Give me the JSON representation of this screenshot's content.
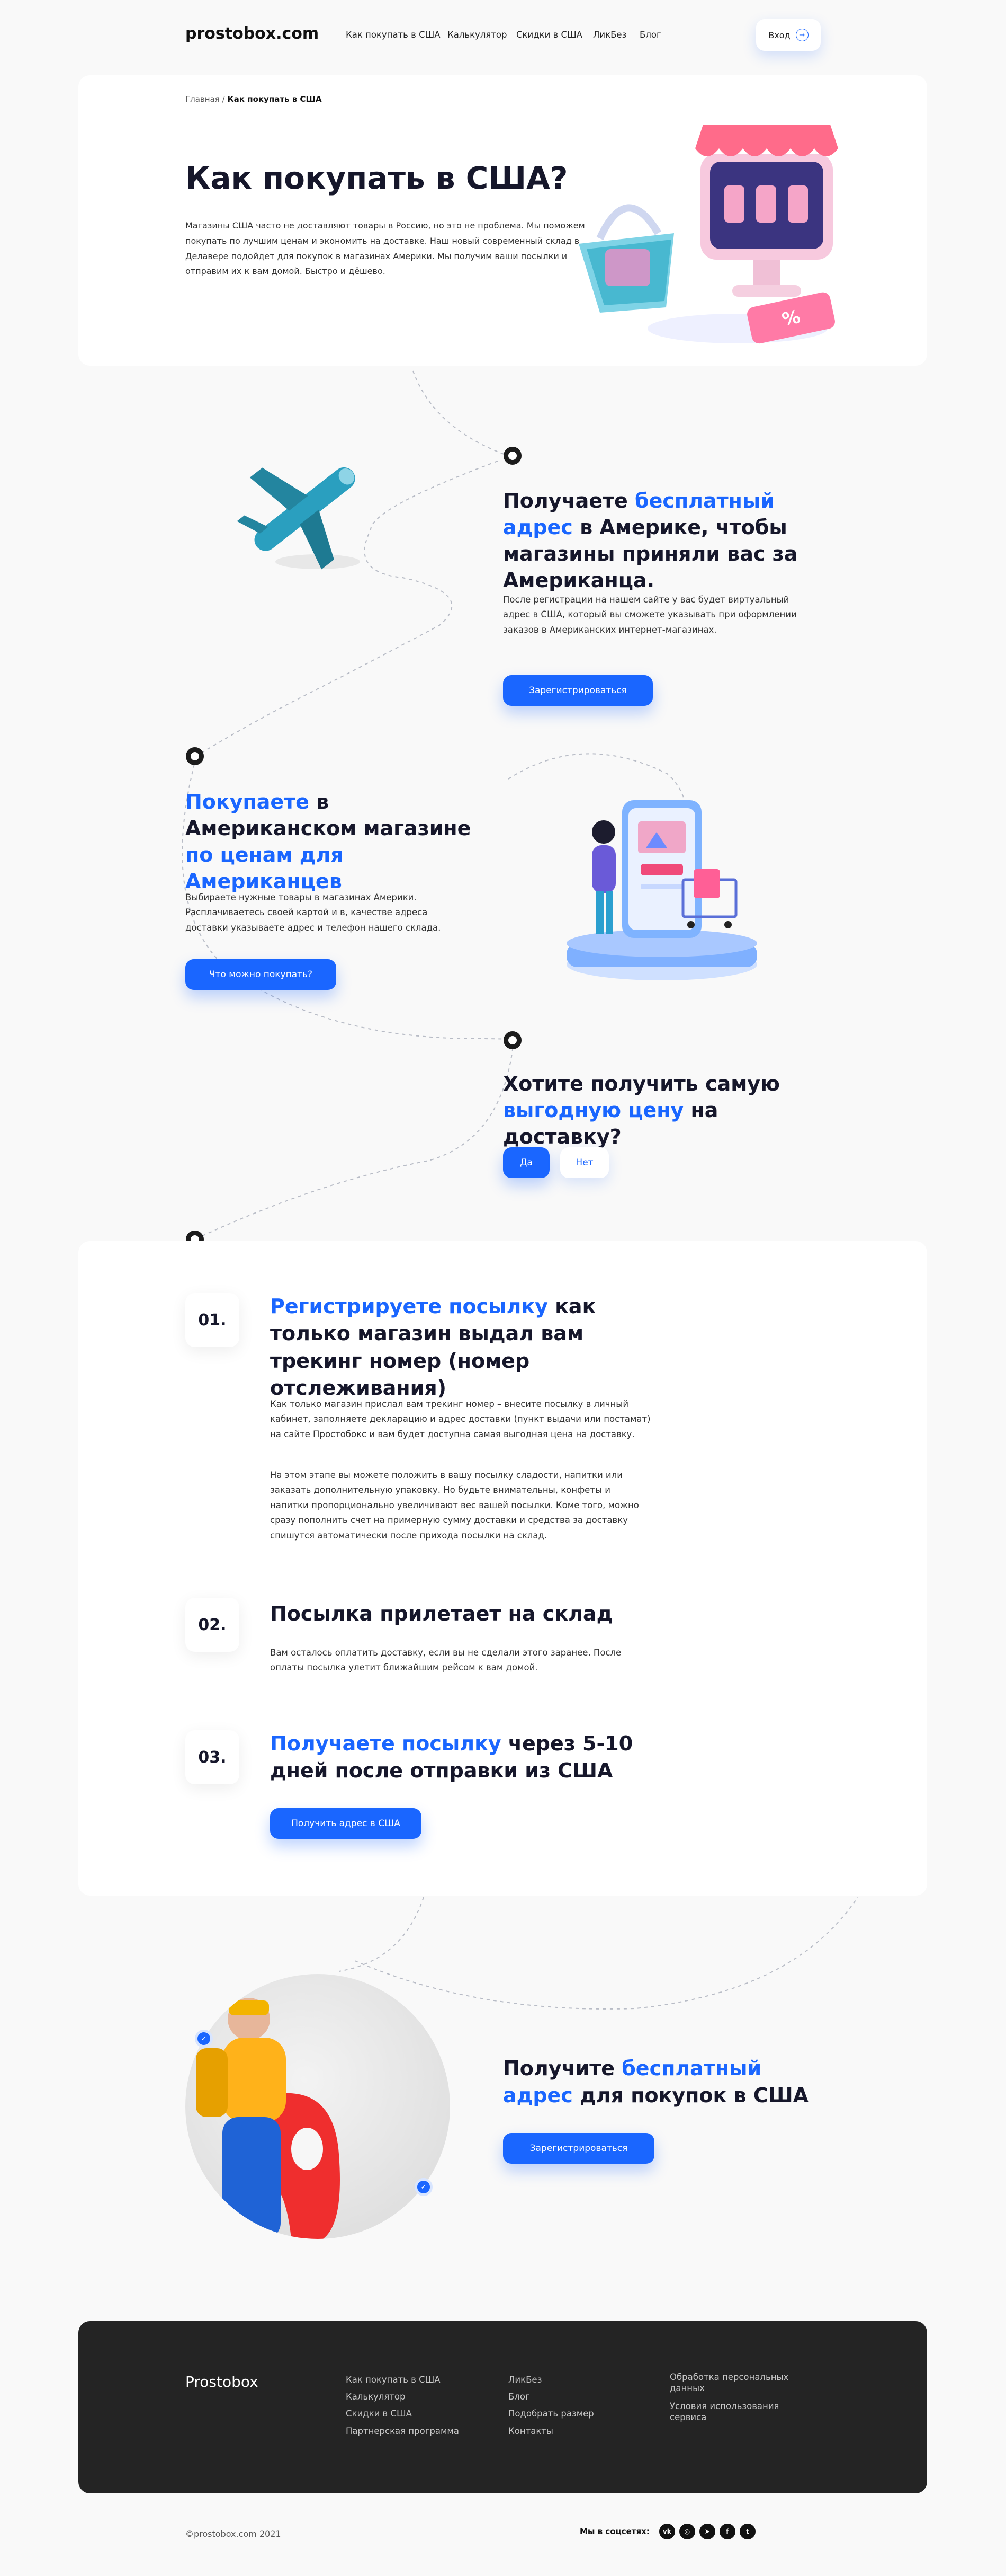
{
  "header": {
    "logo": "prostobox.com",
    "nav": [
      "Как покупать в США",
      "Калькулятор",
      "Скидки в США",
      "ЛикБез",
      "Блог"
    ],
    "login": "Вход",
    "login_icon": "arrow-right-icon"
  },
  "hero": {
    "breadcrumb_home": "Главная",
    "breadcrumb_sep": "/",
    "breadcrumb_current": "Как покупать в США",
    "title": "Как покупать в США?",
    "text": "Магазины США часто не доставляют товары в Россию, но это не проблема. Мы поможем покупать по лучшим ценам и экономить на доставке. Наш новый современный склад в Делавере подойдет для покупок в магазинах Америки. Мы получим ваши посылки и отправим их к вам домой. Быстро и дёшево."
  },
  "step_address": {
    "title_a": "Получаете ",
    "title_b": "бесплатный адрес",
    "title_c": " в Америке, чтобы магазины приняли вас за Американца.",
    "text": "После регистрации на нашем сайте у вас будет виртуальный адрес в США, который вы сможете указывать при оформлении заказов в Американских интернет-магазинах.",
    "button": "Зарегистрироваться"
  },
  "step_shop": {
    "title_a": "Покупаете",
    "title_b": " в Американском магазине ",
    "title_c": "по ценам для Американцев",
    "text": "Выбираете нужные товары в магазинах Америки. Расплачиваетесь своей картой и в, качестве адреса доставки указываете адрес и телефон нашего склада.",
    "button": "Что можно покупать?"
  },
  "question": {
    "title_a": "Хотите получить самую ",
    "title_b": "выгодную цену",
    "title_c": " на доставку?",
    "yes": "Да",
    "no": "Нет"
  },
  "steps": [
    {
      "num": "01.",
      "title_a": "Регистрируете посылку",
      "title_b": " как только магазин выдал вам трекинг номер (номер отслеживания)",
      "p1": "Как только магазин прислал вам трекинг номер – внесите посылку в личный кабинет, заполняете декларацию и адрес доставки (пункт выдачи или постамат) на сайте Простобокс и вам будет доступна самая выгодная цена на доставку.",
      "p2": "На этом этапе вы можете положить в вашу посылку сладости, напитки или заказать дополнительную упаковку. Но будьте внимательны, конфеты и напитки пропорционально увеличивают вес вашей посылки. Коме того, можно сразу пополнить счет на примерную сумму доставки и средства за доставку спишутся автоматически после прихода посылки на склад."
    },
    {
      "num": "02.",
      "title": "Посылка прилетает на склад",
      "p1": "Вам осталось оплатить доставку, если вы не сделали этого заранее. После оплаты посылка улетит ближайшим рейсом к вам домой."
    },
    {
      "num": "03.",
      "title_a": "Получаете посылку",
      "title_b": " через 5-10 дней после отправки из США",
      "button": "Получить адрес в США"
    }
  ],
  "cta": {
    "title_a": "Получите ",
    "title_b": "бесплатный адрес",
    "title_c": " для покупок в США",
    "button": "Зарегистрироваться"
  },
  "footer": {
    "brand": "Prostobox",
    "col1": [
      "Как покупать в США",
      "Калькулятор",
      "Скидки в США",
      "Партнерская программа"
    ],
    "col2": [
      "ЛикБез",
      "Блог",
      "Подобрать размер",
      "Контакты"
    ],
    "col3": [
      "Обработка персональных данных",
      "Условия использования сервиса"
    ],
    "copyright": "©prostobox.com 2021",
    "social_label": "Мы в соцсетях:",
    "social": [
      "vk-icon",
      "instagram-icon",
      "telegram-icon",
      "facebook-icon",
      "twitter-icon"
    ]
  },
  "colors": {
    "accent": "#1a66ff",
    "text": "#16172b",
    "footer_bg": "#242424",
    "page_bg": "#f9f9f9"
  }
}
